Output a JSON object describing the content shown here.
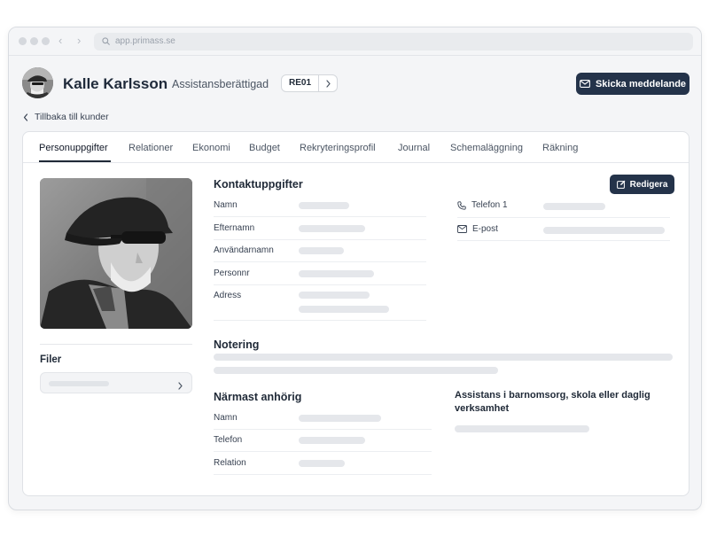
{
  "browser": {
    "url": "app.primass.se"
  },
  "header": {
    "customer_name": "Kalle Karlsson",
    "role": "Assistansberättigad",
    "code": "RE01",
    "send_button_label": "Skicka meddelande"
  },
  "back_link": {
    "label": "Tillbaka till kunder"
  },
  "tabs": [
    {
      "label": "Personuppgifter",
      "active": true
    },
    {
      "label": "Relationer"
    },
    {
      "label": "Ekonomi"
    },
    {
      "label": "Budget"
    },
    {
      "label": "Rekryteringsprofil"
    },
    {
      "label": "Journal"
    },
    {
      "label": "Schemaläggning"
    },
    {
      "label": "Räkning"
    }
  ],
  "files": {
    "title": "Filer"
  },
  "contact": {
    "title": "Kontaktuppgifter",
    "edit_label": "Redigera",
    "fields": [
      {
        "label": "Namn"
      },
      {
        "label": "Efternamn"
      },
      {
        "label": "Användarnamn"
      },
      {
        "label": "Personnr"
      },
      {
        "label": "Adress"
      }
    ],
    "right_fields": [
      {
        "label": "Telefon 1",
        "icon": "phone-icon"
      },
      {
        "label": "E-post",
        "icon": "mail-icon"
      }
    ]
  },
  "notes": {
    "title": "Notering"
  },
  "next_of_kin": {
    "title": "Närmast anhörig",
    "fields": [
      {
        "label": "Namn"
      },
      {
        "label": "Telefon"
      },
      {
        "label": "Relation"
      }
    ]
  },
  "assistance": {
    "title": "Assistans i barnomsorg, skola eller daglig verksamhet"
  },
  "colors": {
    "primary_button": "#24334a",
    "window_bg": "#f4f5f7",
    "skeleton": "#e5e7eb"
  }
}
